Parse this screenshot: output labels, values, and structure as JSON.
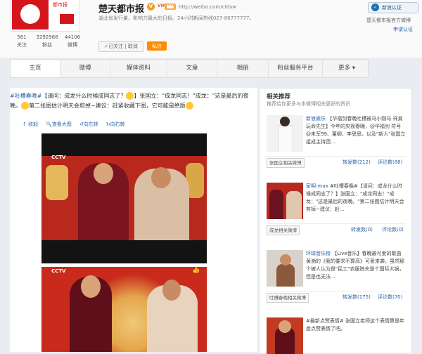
{
  "profile": {
    "name": "楚天都市报",
    "v_badge": "V",
    "vip_label": "VIP",
    "url": "http://weibo.com/ctdsw",
    "intro": "湖北省发行量、影响力最大的日报。24小时新闻热线027-86777777。",
    "logo_text": "都市报",
    "stats": [
      {
        "value": "561",
        "label": "关注"
      },
      {
        "value": "3292968",
        "label": "粉丝"
      },
      {
        "value": "44106",
        "label": "微博"
      }
    ],
    "followed_label": "✓已关注 | 取消",
    "message_label": "私信",
    "verify_label": "新浪认证",
    "official_label": "楚天都市报官方微博",
    "apply_label": "申请认证"
  },
  "nav": {
    "items": [
      "主页",
      "微博",
      "媒体资料",
      "文章",
      "相册",
      "粉丝服务平台",
      "更多 ▾"
    ]
  },
  "post": {
    "tag": "#吐槽春晚#",
    "text_1": "【请问：成龙什么时候成同志了？",
    "text_2": "】张国立：\"成龙同志！\"成龙：\"这是最后的夜",
    "text_3": "晚。",
    "text_4": "第二张图估计明天会剪掉~建议：赶紧收藏下图，它可能是绝版",
    "cctv_label": "CCTV",
    "tools": [
      "↑ 收起",
      "查看大图",
      "向左转",
      "向右转"
    ]
  },
  "sidebar": {
    "title": "相关推荐",
    "subtitle": "推荐给你更多与本微博相关更好的资讯",
    "items": [
      {
        "name": "新浪娱乐",
        "text": "【华福剑春晚吐槽被马小刚马 祥其玩命先生】今年的央视春晚，@华福剑 符号@朱军99、董卿、李思思。以及\"新人\"张国立组成主持团...",
        "button": "张国立相关微博",
        "reposts": "转发数(212)",
        "comments": "评论数(88)"
      },
      {
        "name": "家明-max",
        "text": "#吐槽春晚#【请问：成龙什么时候成同志了？】张国立：\"成龙同志！\"成龙：\"这是最后的夜晚。\"第二张图估计明天会剪掉~建议：赶...",
        "button": "成龙相关微博",
        "reposts": "转发数(0)",
        "comments": "评论数(0)"
      },
      {
        "name": "环球音乐榜",
        "text": "【Live音乐】春晚最可爱的歌曲黄渤的《我的要求不算高》可爱来袭，虽然那个被人认为是\"民工\"衣服除夫是个国际大锅，但是也无法...",
        "button": "吐槽春晚相关微博",
        "reposts": "转发数(175)",
        "comments": "评论数(70)"
      },
      {
        "name": "",
        "text": "#最新点赞表情# 张国立老师这个表情算是年度点赞表情了吧。",
        "button": "",
        "reposts": "",
        "comments": ""
      }
    ]
  },
  "colors": {
    "brand_red": "#d4161c",
    "link_blue": "#2a62a8",
    "orange": "#ff8a00",
    "page_bg": "#e9edf2"
  }
}
